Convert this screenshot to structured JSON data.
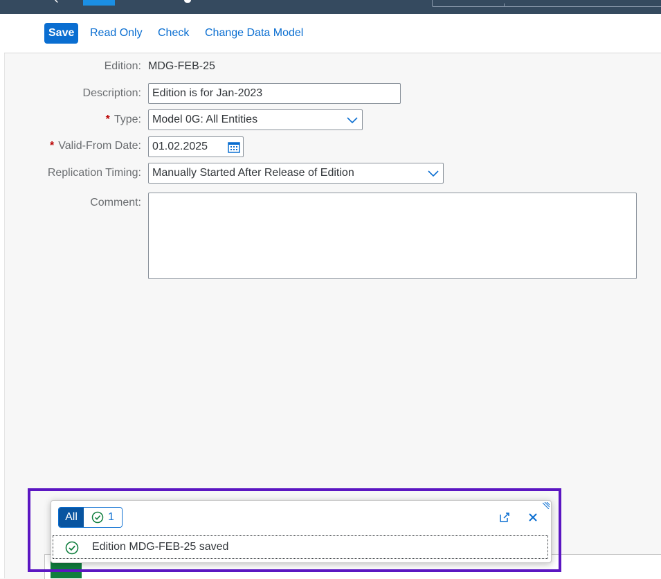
{
  "toolbar": {
    "save": "Save",
    "read_only": "Read Only",
    "check": "Check",
    "change_data_model": "Change Data Model"
  },
  "form": {
    "edition_label": "Edition:",
    "edition_value": "MDG-FEB-25",
    "description_label": "Description:",
    "description_value": "Edition is for Jan-2023",
    "type_label": "Type:",
    "type_value": "Model 0G: All Entities",
    "valid_from_label": "Valid-From Date:",
    "valid_from_value": "01.02.2025",
    "replication_label": "Replication Timing:",
    "replication_value": "Manually Started After Release of Edition",
    "comment_label": "Comment:",
    "comment_value": "",
    "required_marker": "*"
  },
  "messages": {
    "filter_all": "All",
    "success_count": "1",
    "items": [
      {
        "text": "Edition MDG-FEB-25 saved",
        "icon": "success-check-icon"
      }
    ]
  },
  "colors": {
    "shell": "#354a5f",
    "accent": "#0a6ed1",
    "success": "#107e3e",
    "required": "#bb0000",
    "highlight": "#5b16c2"
  }
}
